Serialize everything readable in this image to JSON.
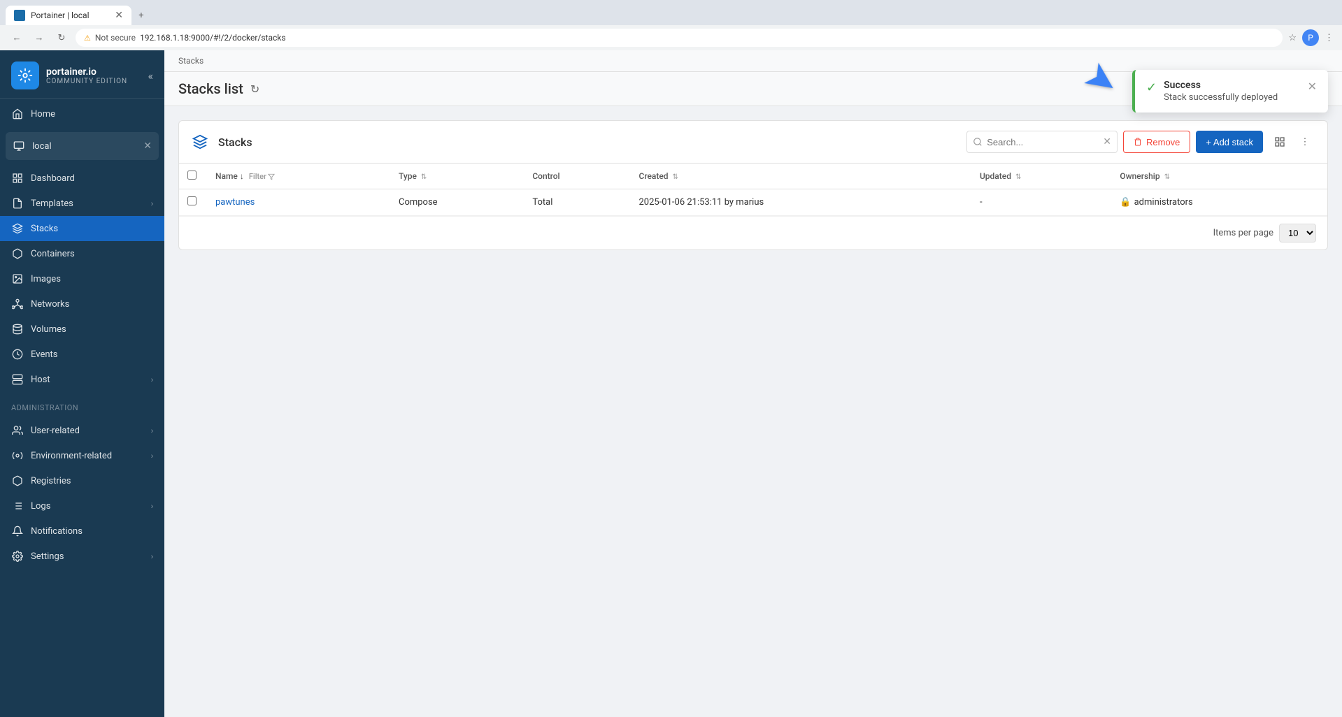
{
  "browser": {
    "tab_title": "Portainer | local",
    "address": "192.168.1.18:9000/#!/2/docker/stacks",
    "address_warning": "Not secure",
    "profile_initial": "P"
  },
  "sidebar": {
    "logo_main": "portainer.io",
    "logo_sub": "Community Edition",
    "home_label": "Home",
    "endpoint": {
      "name": "local",
      "active": true
    },
    "nav_items": [
      {
        "id": "dashboard",
        "label": "Dashboard",
        "icon": "grid"
      },
      {
        "id": "templates",
        "label": "Templates",
        "icon": "file",
        "has_arrow": true
      },
      {
        "id": "stacks",
        "label": "Stacks",
        "icon": "layers",
        "active": true
      },
      {
        "id": "containers",
        "label": "Containers",
        "icon": "box"
      },
      {
        "id": "images",
        "label": "Images",
        "icon": "image"
      },
      {
        "id": "networks",
        "label": "Networks",
        "icon": "network"
      },
      {
        "id": "volumes",
        "label": "Volumes",
        "icon": "database"
      },
      {
        "id": "events",
        "label": "Events",
        "icon": "clock"
      },
      {
        "id": "host",
        "label": "Host",
        "icon": "server",
        "has_arrow": true
      }
    ],
    "admin_section": "Administration",
    "admin_items": [
      {
        "id": "user-related",
        "label": "User-related",
        "has_arrow": true
      },
      {
        "id": "environment-related",
        "label": "Environment-related",
        "has_arrow": true
      },
      {
        "id": "registries",
        "label": "Registries"
      },
      {
        "id": "logs",
        "label": "Logs",
        "has_arrow": true
      },
      {
        "id": "notifications",
        "label": "Notifications"
      },
      {
        "id": "settings",
        "label": "Settings",
        "has_arrow": true
      }
    ]
  },
  "breadcrumb": "Stacks",
  "page_title": "Stacks list",
  "panel": {
    "title": "Stacks",
    "search_placeholder": "Search...",
    "remove_label": "Remove",
    "add_stack_label": "+ Add stack",
    "columns": [
      {
        "key": "name",
        "label": "Name",
        "sortable": true
      },
      {
        "key": "type",
        "label": "Type",
        "sortable": true
      },
      {
        "key": "control",
        "label": "Control"
      },
      {
        "key": "created",
        "label": "Created",
        "sortable": true
      },
      {
        "key": "updated",
        "label": "Updated",
        "sortable": true
      },
      {
        "key": "ownership",
        "label": "Ownership",
        "sortable": true
      }
    ],
    "rows": [
      {
        "name": "pawtunes",
        "type": "Compose",
        "control": "Total",
        "created": "2025-01-06 21:53:11 by marius",
        "updated": "-",
        "ownership": "administrators"
      }
    ],
    "items_per_page_label": "Items per page",
    "items_per_page_value": "10"
  },
  "notification": {
    "title": "Success",
    "message": "Stack successfully deployed"
  }
}
